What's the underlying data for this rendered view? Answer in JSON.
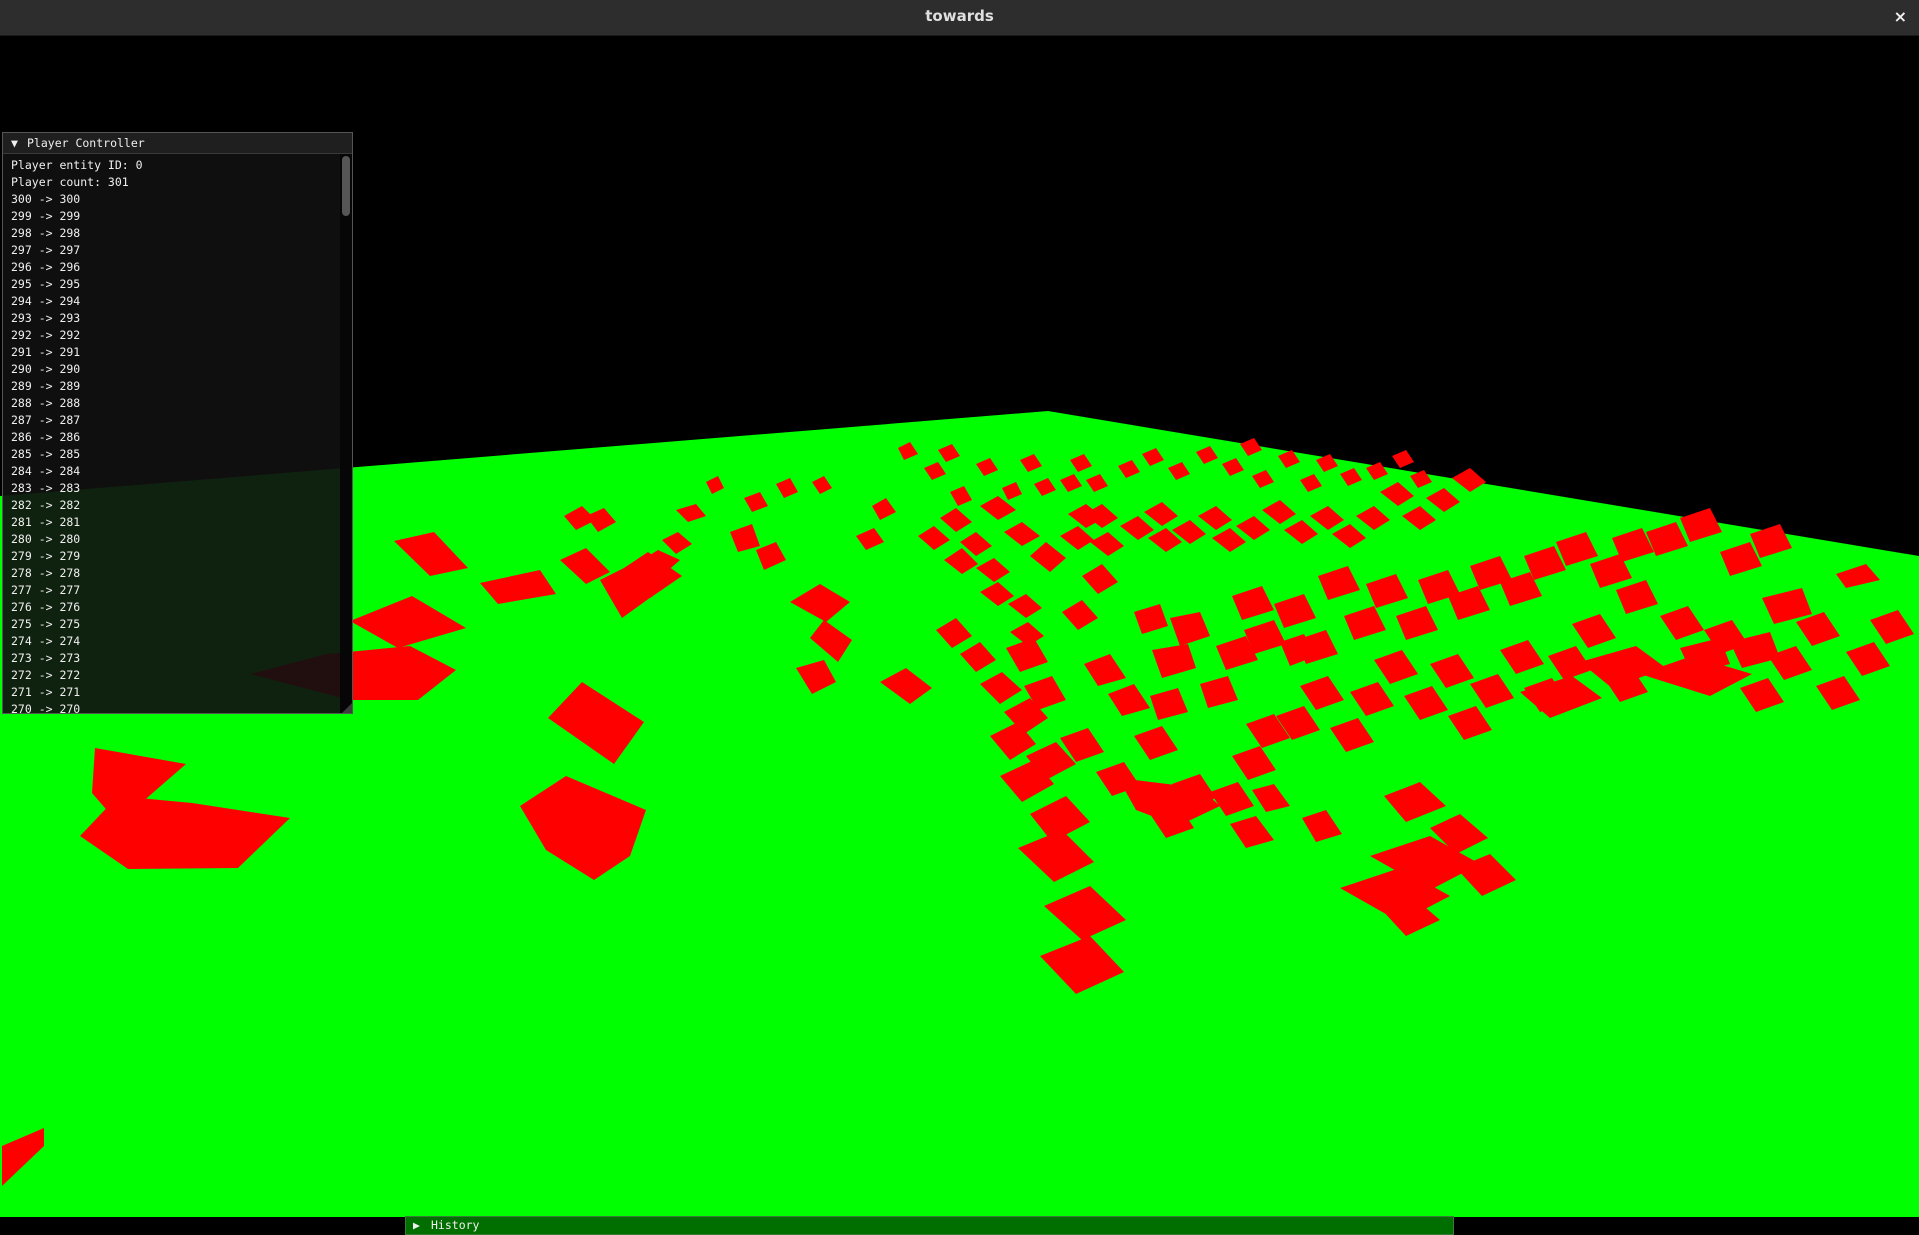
{
  "window": {
    "title": "towards",
    "close_glyph": "×"
  },
  "scene": {
    "ground_color": "#00ff00",
    "sky_color": "#000000",
    "block_color": "#ff0000"
  },
  "player_panel": {
    "title": "Player Controller",
    "expand_glyph": "▼",
    "lines": [
      "Player entity ID: 0",
      "Player count: 301",
      "300 -> 300",
      "299 -> 299",
      "298 -> 298",
      "297 -> 297",
      "296 -> 296",
      "295 -> 295",
      "294 -> 294",
      "293 -> 293",
      "292 -> 292",
      "291 -> 291",
      "290 -> 290",
      "289 -> 289",
      "288 -> 288",
      "287 -> 287",
      "286 -> 286",
      "285 -> 285",
      "284 -> 284",
      "283 -> 283",
      "282 -> 282",
      "281 -> 281",
      "280 -> 280",
      "279 -> 279",
      "278 -> 278",
      "277 -> 277",
      "276 -> 276",
      "275 -> 275",
      "274 -> 274",
      "273 -> 273",
      "272 -> 272",
      "271 -> 271",
      "270 -> 270"
    ]
  },
  "history": {
    "label": "History",
    "expand_glyph": "▶"
  }
}
